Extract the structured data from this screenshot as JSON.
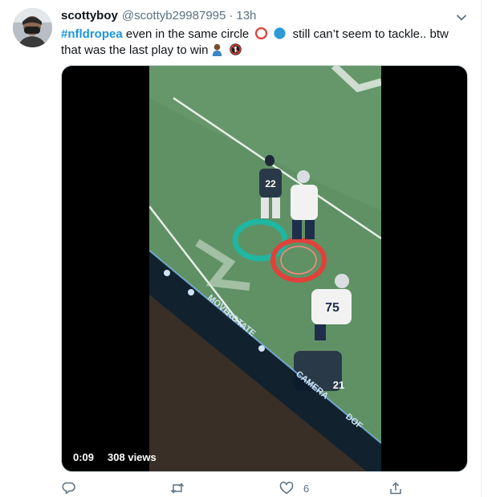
{
  "tweet": {
    "display_name": "scottyboy",
    "handle": "@scottyb29987995",
    "separator": "·",
    "timestamp": "13h",
    "hashtag": "#nfldropea",
    "text_part1": " even in the same circle ",
    "text_part2": " still can’t seem to tackle.. btw",
    "text_line2": "that was the last play to win"
  },
  "video": {
    "duration": "0:09",
    "views": "308 views",
    "overlay_labels": [
      "MOVE",
      "ROTATE",
      "CAMERA",
      "DOF"
    ],
    "jersey_numbers": [
      "22",
      "75",
      "21"
    ]
  },
  "actions": {
    "like_count": "6"
  },
  "colors": {
    "hashtag": "#1b95e0",
    "secondary_text": "#5b7083",
    "field_green": "#5f9165",
    "red_circle": "#e0413a",
    "blue_circle": "#2e9bd6",
    "teal_ring": "#20b6a0"
  },
  "icons": [
    "caret-down-icon",
    "red-circle-emoji",
    "blue-circle-emoji",
    "person-emoji",
    "no-entry-emoji",
    "reply-icon",
    "retweet-icon",
    "like-icon",
    "share-icon"
  ]
}
